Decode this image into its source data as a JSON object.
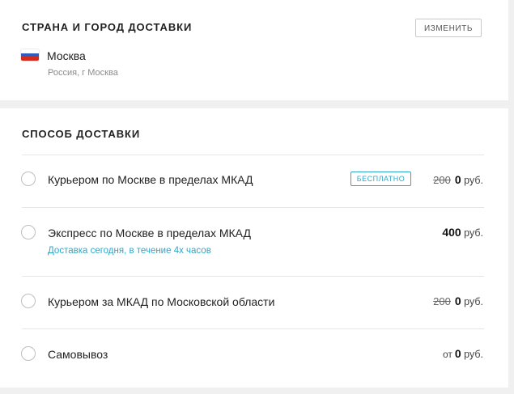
{
  "country_city": {
    "title": "СТРАНА И ГОРОД ДОСТАВКИ",
    "change_button": "ИЗМЕНИТЬ",
    "city": "Москва",
    "city_detail": "Россия, г Москва",
    "flag_icon": "russia-flag-icon"
  },
  "delivery_method": {
    "title": "СПОСОБ ДОСТАВКИ",
    "options": [
      {
        "label": "Курьером по Москве в пределах МКАД",
        "badge": "БЕСПЛАТНО",
        "old_price": "200",
        "price": "0",
        "currency": "руб.",
        "selected": false
      },
      {
        "label": "Экспресс по Москве в пределах МКАД",
        "sublabel": "Доставка сегодня, в течение 4х часов",
        "price": "400",
        "currency": "руб.",
        "selected": false
      },
      {
        "label": "Курьером за МКАД по Московской области",
        "old_price": "200",
        "price": "0",
        "currency": "руб.",
        "selected": false
      },
      {
        "label": "Самовывоз",
        "price_prefix": "от",
        "price": "0",
        "currency": "руб.",
        "selected": false
      }
    ]
  },
  "colors": {
    "accent": "#2aa8c9",
    "background": "#f0f0f0",
    "card": "#ffffff"
  }
}
